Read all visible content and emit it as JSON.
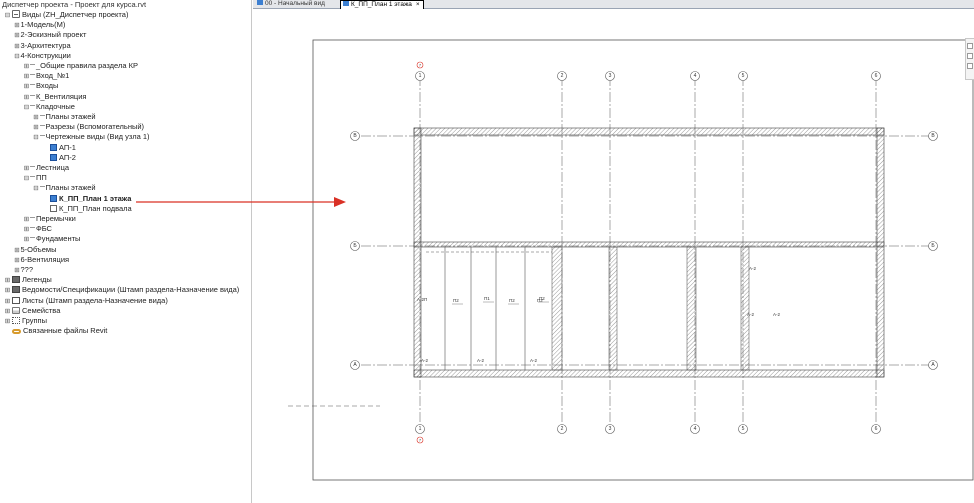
{
  "browser": {
    "title": "Диспетчер проекта - Проект для курса.rvt",
    "tree": [
      {
        "label": "Виды (ZH_Диспетчер проекта)",
        "level": 0,
        "exp": "⊟",
        "icon": "views",
        "bold": false
      },
      {
        "label": "1-Модель(М)",
        "level": 1,
        "exp": "⊞",
        "icon": "",
        "bold": false
      },
      {
        "label": "2-Эскизный проект",
        "level": 1,
        "exp": "⊞",
        "icon": "",
        "bold": false
      },
      {
        "label": "3-Архитектура",
        "level": 1,
        "exp": "⊞",
        "icon": "",
        "bold": false
      },
      {
        "label": "4-Конструкции",
        "level": 1,
        "exp": "⊟",
        "icon": "",
        "bold": false
      },
      {
        "label": "_Общие правила раздела КР",
        "level": 2,
        "exp": "⊞",
        "icon": "dash",
        "bold": false
      },
      {
        "label": "Вход_№1",
        "level": 2,
        "exp": "⊞",
        "icon": "dash",
        "bold": false
      },
      {
        "label": "Входы",
        "level": 2,
        "exp": "⊞",
        "icon": "dash",
        "bold": false
      },
      {
        "label": "К_Вентиляция",
        "level": 2,
        "exp": "⊞",
        "icon": "dash",
        "bold": false
      },
      {
        "label": "Кладочные",
        "level": 2,
        "exp": "⊟",
        "icon": "dash",
        "bold": false
      },
      {
        "label": "Планы этажей",
        "level": 3,
        "exp": "⊞",
        "icon": "dash",
        "bold": false
      },
      {
        "label": "Разрезы (Вспомогательный)",
        "level": 3,
        "exp": "⊞",
        "icon": "dash",
        "bold": false
      },
      {
        "label": "Чертежные виды (Вид узла 1)",
        "level": 3,
        "exp": "⊟",
        "icon": "dash",
        "bold": false
      },
      {
        "label": "АП-1",
        "level": 4,
        "exp": "",
        "icon": "view",
        "bold": false
      },
      {
        "label": "АП-2",
        "level": 4,
        "exp": "",
        "icon": "view",
        "bold": false
      },
      {
        "label": "Лестница",
        "level": 2,
        "exp": "⊞",
        "icon": "dash",
        "bold": false
      },
      {
        "label": "ПП",
        "level": 2,
        "exp": "⊟",
        "icon": "dash",
        "bold": false
      },
      {
        "label": "Планы этажей",
        "level": 3,
        "exp": "⊟",
        "icon": "dash",
        "bold": false
      },
      {
        "label": "К_ПП_План 1 этажа",
        "level": 4,
        "exp": "",
        "icon": "view",
        "bold": true
      },
      {
        "label": "К_ПП_План подвала",
        "level": 4,
        "exp": "",
        "icon": "view-empty",
        "bold": false
      },
      {
        "label": "Перемычки",
        "level": 2,
        "exp": "⊞",
        "icon": "dash",
        "bold": false
      },
      {
        "label": "ФБС",
        "level": 2,
        "exp": "⊞",
        "icon": "dash",
        "bold": false
      },
      {
        "label": "Фундаменты",
        "level": 2,
        "exp": "⊞",
        "icon": "dash",
        "bold": false
      },
      {
        "label": "5-Объемы",
        "level": 1,
        "exp": "⊞",
        "icon": "",
        "bold": false
      },
      {
        "label": "6-Вентиляция",
        "level": 1,
        "exp": "⊞",
        "icon": "",
        "bold": false
      },
      {
        "label": "???",
        "level": 1,
        "exp": "⊞",
        "icon": "",
        "bold": false
      },
      {
        "label": "Легенды",
        "level": 0,
        "exp": "⊞",
        "icon": "leg",
        "bold": false
      },
      {
        "label": "Ведомости/Спецификации (Штамп раздела-Назначение вида)",
        "level": 0,
        "exp": "⊞",
        "icon": "leg",
        "bold": false
      },
      {
        "label": "Листы (Штамп раздела-Назначение вида)",
        "level": 0,
        "exp": "⊞",
        "icon": "sheet",
        "bold": false
      },
      {
        "label": "Семейства",
        "level": 0,
        "exp": "⊞",
        "icon": "fam",
        "bold": false
      },
      {
        "label": "Группы",
        "level": 0,
        "exp": "⊞",
        "icon": "grp",
        "bold": false
      },
      {
        "label": "Связанные файлы Revit",
        "level": 0,
        "exp": "",
        "icon": "link",
        "bold": false
      }
    ]
  },
  "tabs": {
    "start_label": "00 - Начальный вид",
    "active_label": "К_ПП_План 1 этажа",
    "close_glyph": "×"
  },
  "drawing": {
    "grid_top_labels": [
      "1",
      "2",
      "3",
      "4",
      "5",
      "6"
    ],
    "grid_side_labels": [
      "В",
      "Б",
      "А"
    ],
    "level_marker_label": "7",
    "room_labels": [
      "П2",
      "П1",
      "П2",
      "П2"
    ],
    "section_labels": [
      "А-2П",
      "П2",
      "А-2",
      "А-2",
      "А-2",
      "А-2",
      "А-2",
      "А-2"
    ],
    "accent_color": "#d93025",
    "annotation_color": "#d93025"
  }
}
